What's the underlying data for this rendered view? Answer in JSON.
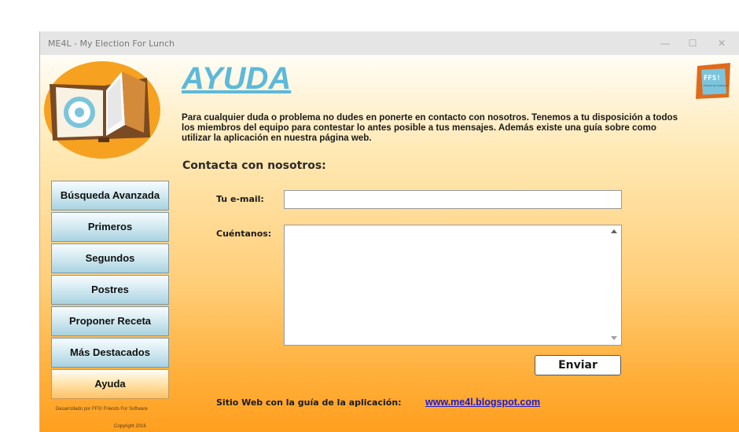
{
  "window": {
    "title": "ME4L - My Election For Lunch",
    "controls": {
      "minimize": "—",
      "maximize": "☐",
      "close": "✕"
    }
  },
  "sidebar": {
    "items": [
      {
        "label": "Búsqueda Avanzada"
      },
      {
        "label": "Primeros"
      },
      {
        "label": "Segundos"
      },
      {
        "label": "Postres"
      },
      {
        "label": "Proponer Receta"
      },
      {
        "label": "Más Destacados"
      },
      {
        "label": "Ayuda",
        "active": true
      }
    ],
    "credits": "Desarrollado por FFS! Friends For Software",
    "copyright": "Copyright 2016"
  },
  "main": {
    "title": "AYUDA",
    "intro": "Para cualquier duda o problema no dudes en ponerte en contacto con nosotros. Tenemos a tu disposición a todos los miembros del equipo para contestar lo antes posible a tus mensajes.  Además existe una guía sobre como utilizar la aplicación en nuestra página web.",
    "contact_heading": "Contacta con nosotros:",
    "email_label": "Tu e-mail:",
    "email_value": "",
    "message_label": "Cuéntanos:",
    "message_value": "",
    "send_label": "Enviar",
    "site_label": "Sitio Web con la guía de la aplicación:",
    "site_link": "www.me4l.blogspot.com"
  },
  "brand": {
    "ffs_logo_text": "FFS!",
    "ffs_small_text": "Friends For Software"
  },
  "colors": {
    "title_blue": "#5cb9da",
    "nav_blue": "#a9d2e0",
    "active_orange": "#ffc266",
    "link": "#1a1ad8"
  },
  "icons": {
    "app_logo": "book-icon",
    "partner_logo": "ffs-logo-icon",
    "scroll_up": "scroll-up-icon",
    "scroll_down": "scroll-down-icon"
  }
}
